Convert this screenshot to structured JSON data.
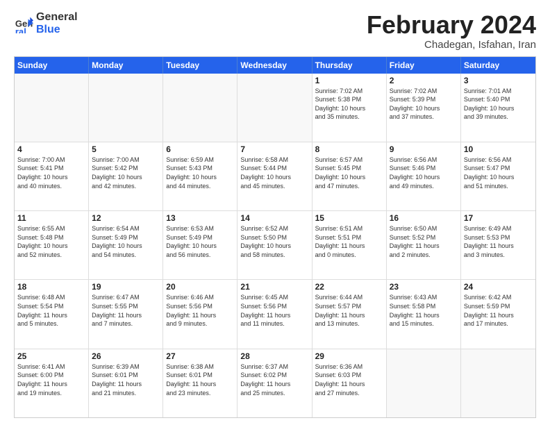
{
  "logo": {
    "line1": "General",
    "line2": "Blue"
  },
  "title": "February 2024",
  "subtitle": "Chadegan, Isfahan, Iran",
  "days": [
    "Sunday",
    "Monday",
    "Tuesday",
    "Wednesday",
    "Thursday",
    "Friday",
    "Saturday"
  ],
  "weeks": [
    [
      {
        "day": "",
        "info": ""
      },
      {
        "day": "",
        "info": ""
      },
      {
        "day": "",
        "info": ""
      },
      {
        "day": "",
        "info": ""
      },
      {
        "day": "1",
        "info": "Sunrise: 7:02 AM\nSunset: 5:38 PM\nDaylight: 10 hours\nand 35 minutes."
      },
      {
        "day": "2",
        "info": "Sunrise: 7:02 AM\nSunset: 5:39 PM\nDaylight: 10 hours\nand 37 minutes."
      },
      {
        "day": "3",
        "info": "Sunrise: 7:01 AM\nSunset: 5:40 PM\nDaylight: 10 hours\nand 39 minutes."
      }
    ],
    [
      {
        "day": "4",
        "info": "Sunrise: 7:00 AM\nSunset: 5:41 PM\nDaylight: 10 hours\nand 40 minutes."
      },
      {
        "day": "5",
        "info": "Sunrise: 7:00 AM\nSunset: 5:42 PM\nDaylight: 10 hours\nand 42 minutes."
      },
      {
        "day": "6",
        "info": "Sunrise: 6:59 AM\nSunset: 5:43 PM\nDaylight: 10 hours\nand 44 minutes."
      },
      {
        "day": "7",
        "info": "Sunrise: 6:58 AM\nSunset: 5:44 PM\nDaylight: 10 hours\nand 45 minutes."
      },
      {
        "day": "8",
        "info": "Sunrise: 6:57 AM\nSunset: 5:45 PM\nDaylight: 10 hours\nand 47 minutes."
      },
      {
        "day": "9",
        "info": "Sunrise: 6:56 AM\nSunset: 5:46 PM\nDaylight: 10 hours\nand 49 minutes."
      },
      {
        "day": "10",
        "info": "Sunrise: 6:56 AM\nSunset: 5:47 PM\nDaylight: 10 hours\nand 51 minutes."
      }
    ],
    [
      {
        "day": "11",
        "info": "Sunrise: 6:55 AM\nSunset: 5:48 PM\nDaylight: 10 hours\nand 52 minutes."
      },
      {
        "day": "12",
        "info": "Sunrise: 6:54 AM\nSunset: 5:49 PM\nDaylight: 10 hours\nand 54 minutes."
      },
      {
        "day": "13",
        "info": "Sunrise: 6:53 AM\nSunset: 5:49 PM\nDaylight: 10 hours\nand 56 minutes."
      },
      {
        "day": "14",
        "info": "Sunrise: 6:52 AM\nSunset: 5:50 PM\nDaylight: 10 hours\nand 58 minutes."
      },
      {
        "day": "15",
        "info": "Sunrise: 6:51 AM\nSunset: 5:51 PM\nDaylight: 11 hours\nand 0 minutes."
      },
      {
        "day": "16",
        "info": "Sunrise: 6:50 AM\nSunset: 5:52 PM\nDaylight: 11 hours\nand 2 minutes."
      },
      {
        "day": "17",
        "info": "Sunrise: 6:49 AM\nSunset: 5:53 PM\nDaylight: 11 hours\nand 3 minutes."
      }
    ],
    [
      {
        "day": "18",
        "info": "Sunrise: 6:48 AM\nSunset: 5:54 PM\nDaylight: 11 hours\nand 5 minutes."
      },
      {
        "day": "19",
        "info": "Sunrise: 6:47 AM\nSunset: 5:55 PM\nDaylight: 11 hours\nand 7 minutes."
      },
      {
        "day": "20",
        "info": "Sunrise: 6:46 AM\nSunset: 5:56 PM\nDaylight: 11 hours\nand 9 minutes."
      },
      {
        "day": "21",
        "info": "Sunrise: 6:45 AM\nSunset: 5:56 PM\nDaylight: 11 hours\nand 11 minutes."
      },
      {
        "day": "22",
        "info": "Sunrise: 6:44 AM\nSunset: 5:57 PM\nDaylight: 11 hours\nand 13 minutes."
      },
      {
        "day": "23",
        "info": "Sunrise: 6:43 AM\nSunset: 5:58 PM\nDaylight: 11 hours\nand 15 minutes."
      },
      {
        "day": "24",
        "info": "Sunrise: 6:42 AM\nSunset: 5:59 PM\nDaylight: 11 hours\nand 17 minutes."
      }
    ],
    [
      {
        "day": "25",
        "info": "Sunrise: 6:41 AM\nSunset: 6:00 PM\nDaylight: 11 hours\nand 19 minutes."
      },
      {
        "day": "26",
        "info": "Sunrise: 6:39 AM\nSunset: 6:01 PM\nDaylight: 11 hours\nand 21 minutes."
      },
      {
        "day": "27",
        "info": "Sunrise: 6:38 AM\nSunset: 6:01 PM\nDaylight: 11 hours\nand 23 minutes."
      },
      {
        "day": "28",
        "info": "Sunrise: 6:37 AM\nSunset: 6:02 PM\nDaylight: 11 hours\nand 25 minutes."
      },
      {
        "day": "29",
        "info": "Sunrise: 6:36 AM\nSunset: 6:03 PM\nDaylight: 11 hours\nand 27 minutes."
      },
      {
        "day": "",
        "info": ""
      },
      {
        "day": "",
        "info": ""
      }
    ]
  ]
}
